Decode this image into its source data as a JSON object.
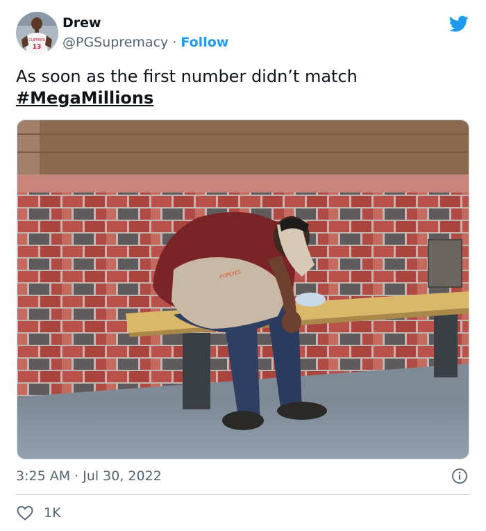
{
  "author": {
    "name": "Drew",
    "handle": "@PGSupremacy",
    "separator": "·",
    "follow_label": "Follow",
    "avatar_jersey_text": "CLIPPERS",
    "avatar_jersey_number": "13"
  },
  "tweet": {
    "text": "As soon as the first number didn’t match",
    "hashtag": "#MegaMillions",
    "apron_logo_text": "POPEYES"
  },
  "meta": {
    "timestamp": "3:25 AM · Jul 30, 2022"
  },
  "actions": {
    "like_count": "1K"
  },
  "colors": {
    "accent": "#1d9bf0",
    "text_secondary": "#536471",
    "divider": "#cfd9de"
  },
  "icons": {
    "brand": "twitter-bird-icon",
    "info": "info-icon",
    "like": "heart-icon"
  }
}
